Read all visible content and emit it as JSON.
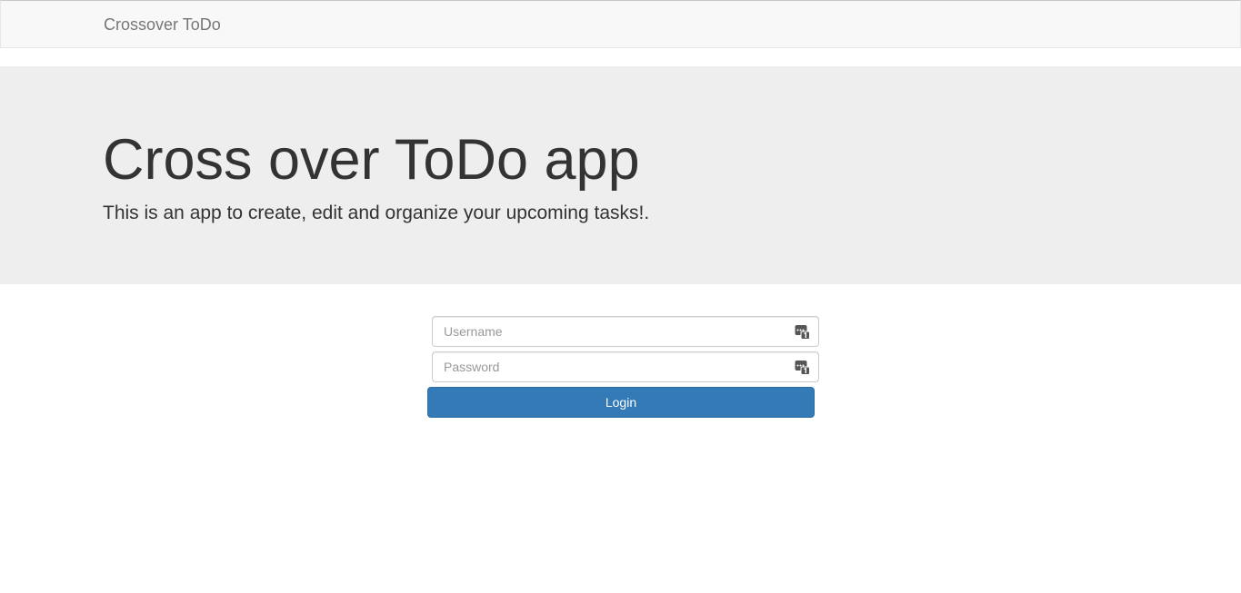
{
  "navbar": {
    "brand": "Crossover ToDo"
  },
  "jumbotron": {
    "title": "Cross over ToDo app",
    "subtitle": "This is an app to create, edit and organize your upcoming tasks!."
  },
  "login_form": {
    "username": {
      "placeholder": "Username",
      "value": "",
      "icon": "password-manager-icon"
    },
    "password": {
      "placeholder": "Password",
      "value": "",
      "icon": "password-manager-icon"
    },
    "submit_label": "Login"
  },
  "colors": {
    "navbar_bg": "#f8f8f8",
    "jumbotron_bg": "#eeeeee",
    "primary": "#337ab7"
  }
}
